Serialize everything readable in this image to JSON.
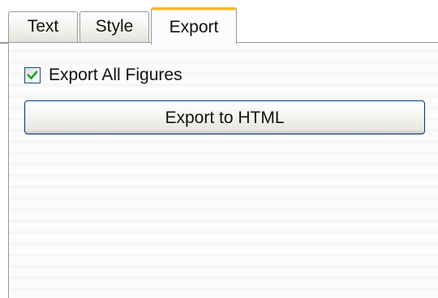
{
  "tabs": [
    {
      "label": "Text",
      "selected": false
    },
    {
      "label": "Style",
      "selected": false
    },
    {
      "label": "Export",
      "selected": true
    }
  ],
  "export": {
    "checkbox_label": "Export All Figures",
    "checkbox_checked": true,
    "button_label": "Export to HTML"
  },
  "colors": {
    "tab_border": "#919b9c",
    "active_tab_highlight": "#f7b32e",
    "checkmark": "#21a121",
    "button_border": "#003c74"
  },
  "icons": {
    "checkbox": "checkmark-icon"
  }
}
